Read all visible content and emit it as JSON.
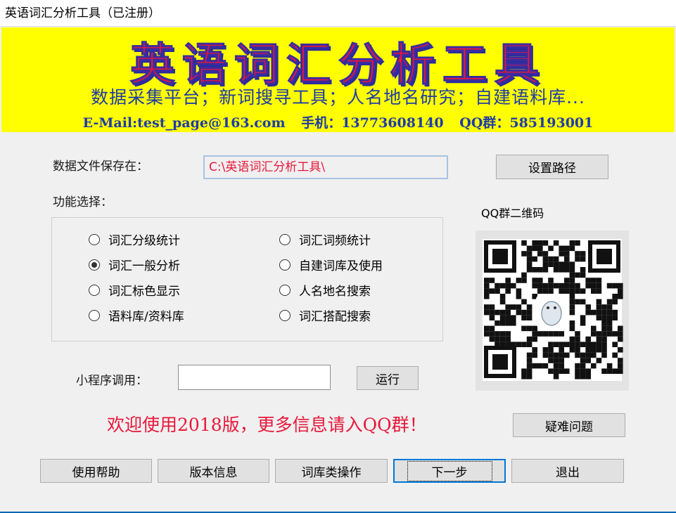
{
  "window": {
    "title": "英语词汇分析工具（已注册）"
  },
  "banner": {
    "title": "英语词汇分析工具",
    "subtitle": "数据采集平台；新词搜寻工具；人名地名研究；自建语料库...",
    "email": "E-Mail:test_page@163.com",
    "phone": "手机：13773608140",
    "qq_group": "QQ群：585193001"
  },
  "path": {
    "label": "数据文件保存在：",
    "value": "C:\\英语词汇分析工具\\",
    "set_button": "设置路径"
  },
  "functions": {
    "label": "功能选择：",
    "options": [
      {
        "label": "词汇分级统计",
        "selected": false
      },
      {
        "label": "词汇词频统计",
        "selected": false
      },
      {
        "label": "词汇一般分析",
        "selected": true
      },
      {
        "label": "自建词库及使用",
        "selected": false
      },
      {
        "label": "词汇标色显示",
        "selected": false
      },
      {
        "label": "人名地名搜索",
        "selected": false
      },
      {
        "label": "语料库/资料库",
        "selected": false
      },
      {
        "label": "词汇搭配搜索",
        "selected": false
      }
    ]
  },
  "miniprogram": {
    "label": "小程序调用：",
    "value": "",
    "run_button": "运行"
  },
  "qr": {
    "label": "QQ群二维码"
  },
  "welcome": "欢迎使用2018版，更多信息请入QQ群！",
  "buttons": {
    "faq": "疑难问题",
    "help": "使用帮助",
    "version": "版本信息",
    "library": "词库类操作",
    "next": "下一步",
    "exit": "退出"
  },
  "colors": {
    "banner_bg": "#ffff00",
    "title_red": "#e8173a",
    "title_blue": "#1e3ba8",
    "focus_blue": "#0078d7"
  }
}
